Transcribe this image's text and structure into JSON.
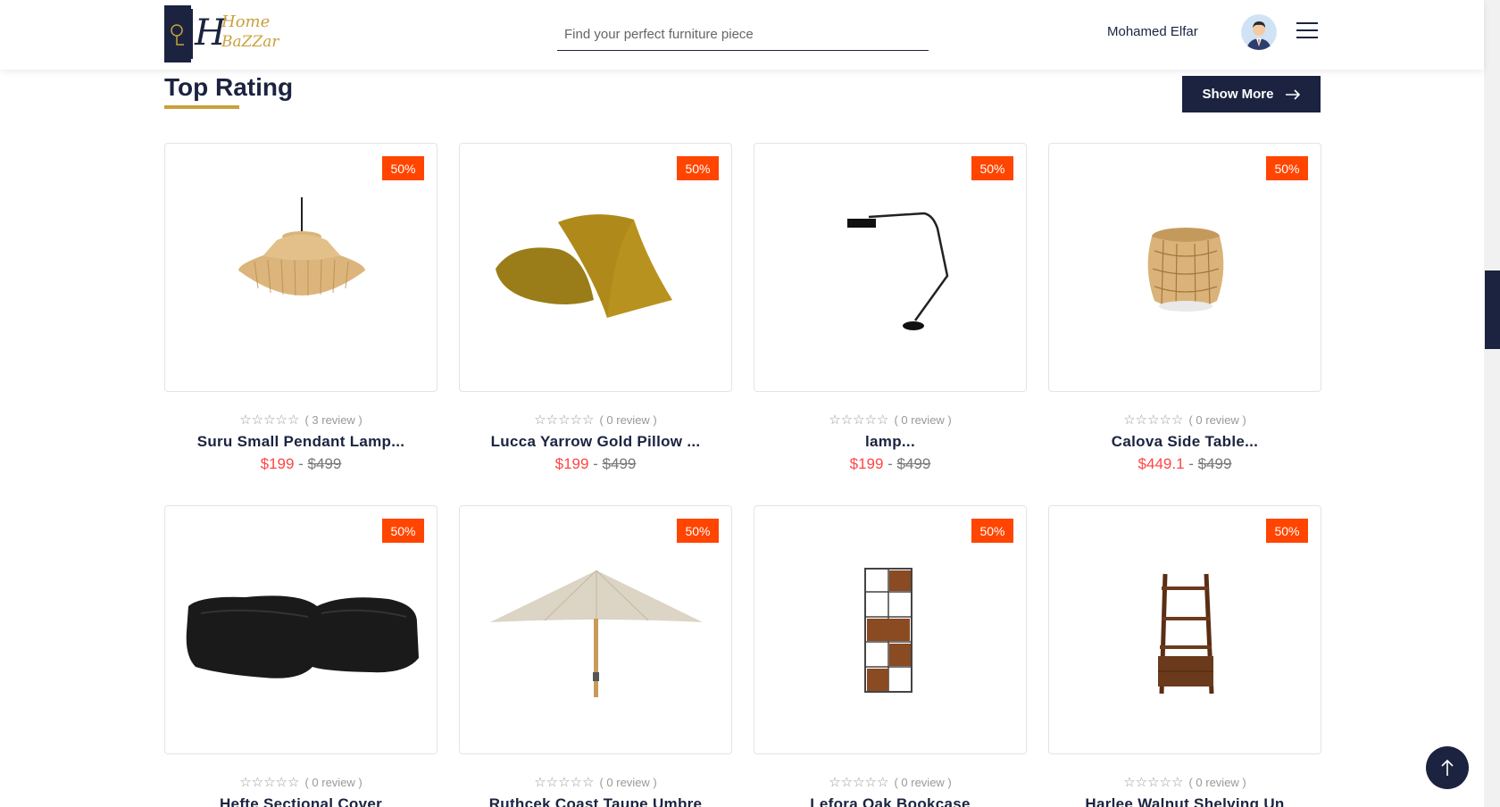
{
  "header": {
    "logo_text_top": "Home",
    "logo_text_bottom": "BaZZar",
    "search_placeholder": "Find your perfect furniture piece",
    "user_name": "Mohamed Elfar"
  },
  "section": {
    "title": "Top Rating",
    "show_more_label": "Show More"
  },
  "colors": {
    "navy": "#1b2340",
    "gold": "#c9a13b",
    "badge": "#ff4500",
    "price_red": "#ff4545"
  },
  "products": [
    {
      "badge": "50%",
      "stars": "☆☆☆☆☆",
      "reviews": "( 3 review )",
      "name": "Suru Small Pendant Lamp...",
      "price": "$199",
      "sep": " - ",
      "old_price": "$499",
      "icon": "pendant-lamp-icon"
    },
    {
      "badge": "50%",
      "stars": "☆☆☆☆☆",
      "reviews": "( 0 review )",
      "name": "Lucca Yarrow Gold Pillow ...",
      "price": "$199",
      "sep": " - ",
      "old_price": "$499",
      "icon": "pillow-icon"
    },
    {
      "badge": "50%",
      "stars": "☆☆☆☆☆",
      "reviews": "( 0 review )",
      "name": "lamp...",
      "price": "$199",
      "sep": " - ",
      "old_price": "$499",
      "icon": "floor-lamp-icon"
    },
    {
      "badge": "50%",
      "stars": "☆☆☆☆☆",
      "reviews": "( 0 review )",
      "name": "Calova Side Table...",
      "price": "$449.1",
      "sep": " - ",
      "old_price": "$499",
      "icon": "side-table-icon"
    },
    {
      "badge": "50%",
      "stars": "☆☆☆☆☆",
      "reviews": "( 0 review )",
      "name": "Hefte Sectional Cover",
      "price": "",
      "sep": "",
      "old_price": "",
      "icon": "sofa-cover-icon"
    },
    {
      "badge": "50%",
      "stars": "☆☆☆☆☆",
      "reviews": "( 0 review )",
      "name": "Ruthcek Coast Taupe Umbre",
      "price": "",
      "sep": "",
      "old_price": "",
      "icon": "umbrella-icon"
    },
    {
      "badge": "50%",
      "stars": "☆☆☆☆☆",
      "reviews": "( 0 review )",
      "name": "Lefora Oak Bookcase",
      "price": "",
      "sep": "",
      "old_price": "",
      "icon": "bookcase-icon"
    },
    {
      "badge": "50%",
      "stars": "☆☆☆☆☆",
      "reviews": "( 0 review )",
      "name": "Harlee Walnut Shelving Un",
      "price": "",
      "sep": "",
      "old_price": "",
      "icon": "ladder-shelf-icon"
    }
  ]
}
